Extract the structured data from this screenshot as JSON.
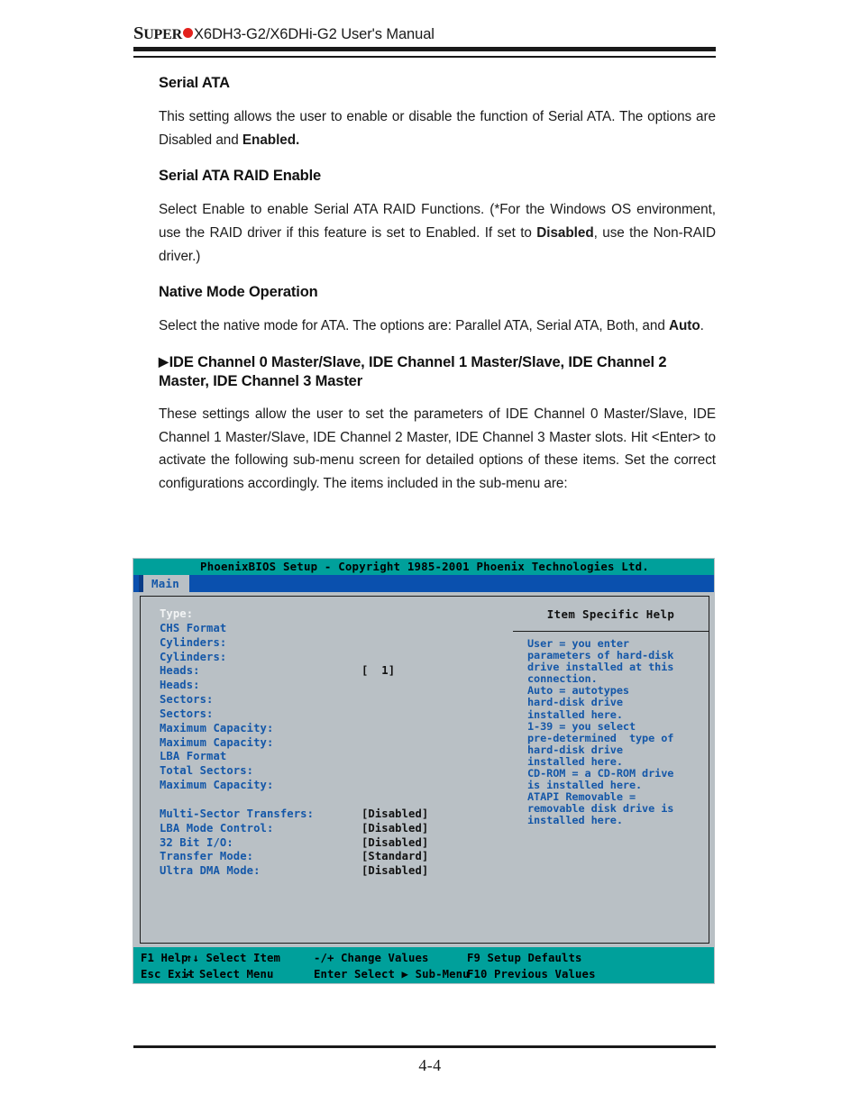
{
  "header": {
    "brand_caps": "S",
    "brand_rest": "UPER",
    "dot_color": "#e3211c",
    "title": "X6DH3-G2/X6DHi-G2 User's Manual"
  },
  "sections": [
    {
      "heading": "Serial ATA",
      "paragraph_html": "This setting allows the user to enable or disable the function of  Serial ATA.  The options are Disabled and  <b>Enabled.</b>"
    },
    {
      "heading": "Serial ATA RAID Enable",
      "paragraph_html": "Select Enable to enable Serial ATA RAID Functions. (*For the Windows OS environment, use the RAID driver if this feature is set to Enabled. If set to <b>Disabled</b>, use the Non-RAID driver.)"
    },
    {
      "heading": "Native Mode Operation",
      "paragraph_html": "Select the native mode for ATA. The options are: Parallel ATA, Serial ATA, Both, and <b>Auto</b>."
    },
    {
      "heading": "IDE Channel 0 Master/Slave, IDE Channel 1 Master/Slave, IDE Channel 2 Master, IDE Channel 3 Master",
      "bullet": "▶",
      "paragraph_html": "These settings allow the user to set the parameters of  IDE Channel 0 Master/Slave, IDE Channel 1 Master/Slave, IDE Channel 2 Master, IDE Channel 3 Master slots.  Hit &lt;Enter&gt; to activate  the following sub-menu screen for detailed options of these items. Set the correct configurations accordingly.  The items included in the sub-menu are:"
    }
  ],
  "bios": {
    "title": "PhoenixBIOS Setup - Copyright 1985-2001 Phoenix Technologies Ltd.",
    "menu_tab": "Main",
    "colors": {
      "teal": "#00a09b",
      "menu_blue": "#0a50ae",
      "panel_gray": "#b9c0c5",
      "label_blue": "#1457a8",
      "value_black": "#111111",
      "selected_white": "#f2f4f5"
    },
    "settings": [
      {
        "label": "Type:",
        "value": "",
        "selected": true
      },
      {
        "label": "CHS Format",
        "value": "",
        "selected": false
      },
      {
        "label": "Cylinders:",
        "value": "",
        "selected": false
      },
      {
        "label": "Cylinders:",
        "value": "",
        "selected": false
      },
      {
        "label": "Heads:",
        "value": "[  1]",
        "selected": false
      },
      {
        "label": "Heads:",
        "value": "",
        "selected": false
      },
      {
        "label": "Sectors:",
        "value": "",
        "selected": false
      },
      {
        "label": "Sectors:",
        "value": "",
        "selected": false
      },
      {
        "label": "Maximum Capacity:",
        "value": "",
        "selected": false
      },
      {
        "label": "Maximum Capacity:",
        "value": "",
        "selected": false
      },
      {
        "label": "LBA Format",
        "value": "",
        "selected": false
      },
      {
        "label": "Total Sectors:",
        "value": "",
        "selected": false
      },
      {
        "label": "Maximum Capacity:",
        "value": "",
        "selected": false
      }
    ],
    "settings2": [
      {
        "label": "Multi-Sector Transfers:",
        "value": "[Disabled]"
      },
      {
        "label": "LBA Mode Control:",
        "value": "[Disabled]"
      },
      {
        "label": "32 Bit I/O:",
        "value": "[Disabled]"
      },
      {
        "label": "Transfer Mode:",
        "value": "[Standard]"
      },
      {
        "label": "Ultra DMA Mode:",
        "value": "[Disabled]"
      }
    ],
    "help": {
      "title": "Item Specific Help",
      "body": "User = you enter\nparameters of hard-disk\ndrive installed at this\nconnection.\nAuto = autotypes\nhard-disk drive\ninstalled here.\n1-39 = you select\npre-determined  type of\nhard-disk drive\ninstalled here.\nCD-ROM = a CD-ROM drive\nis installed here.\nATAPI Removable =\nremovable disk drive is\ninstalled here."
    },
    "footer": {
      "row1": [
        {
          "key": "F1",
          "label": "Help"
        },
        {
          "key": "↑↓",
          "label": "Select Item"
        },
        {
          "key": "-/+",
          "label": "Change Values"
        },
        {
          "key": "F9",
          "label": "Setup Defaults"
        }
      ],
      "row2": [
        {
          "key": "Esc",
          "label": "Exit"
        },
        {
          "key": "↔",
          "label": "Select Menu"
        },
        {
          "key": "Enter",
          "label": "Select ▶ Sub-Menu"
        },
        {
          "key": "F10",
          "label": "Previous Values"
        }
      ]
    }
  },
  "page_number": "4-4"
}
